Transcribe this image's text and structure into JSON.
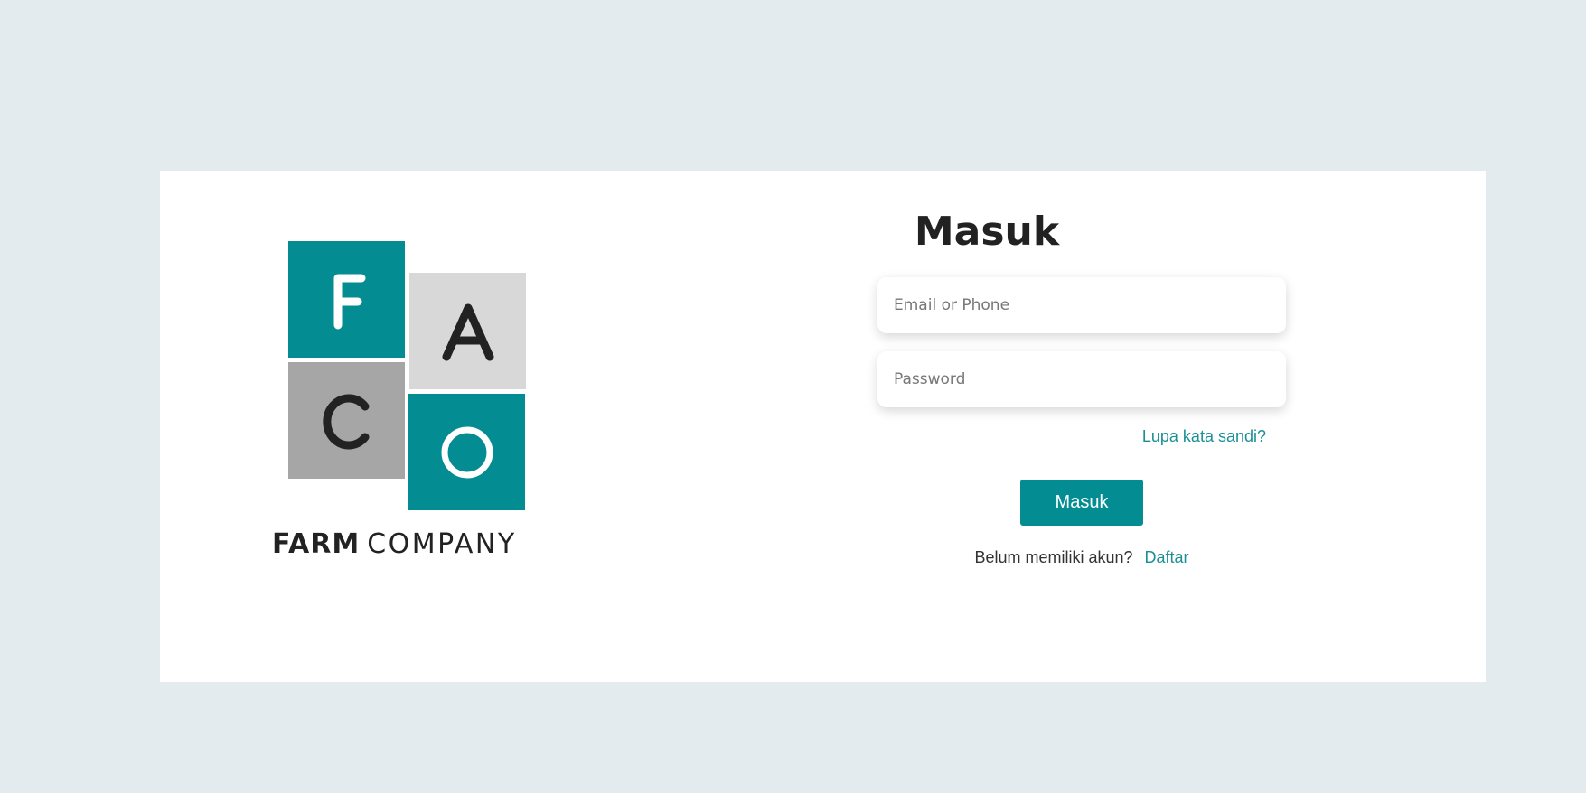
{
  "logo": {
    "tiles": [
      "F",
      "A",
      "C",
      "O"
    ],
    "brand_bold": "FARM",
    "brand_light": "COMPANY",
    "colors": {
      "teal": "#038c92",
      "light_gray": "#d8d8d8",
      "mid_gray": "#a6a6a6"
    }
  },
  "login": {
    "title": "Masuk",
    "email_placeholder": "Email or Phone",
    "password_placeholder": "Password",
    "forgot_label": "Lupa kata sandi?",
    "submit_label": "Masuk",
    "register_prompt": "Belum memiliki akun?",
    "register_link": "Daftar"
  },
  "theme": {
    "background": "#e3ebee",
    "card": "#ffffff",
    "accent": "#038c92",
    "link": "#1a8f96",
    "text": "#222222"
  }
}
